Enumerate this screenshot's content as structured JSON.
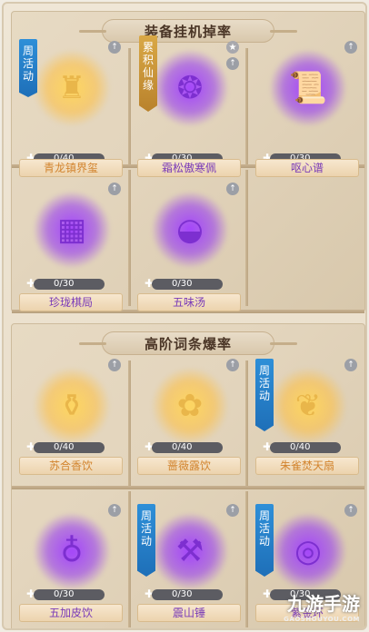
{
  "sections": [
    {
      "title": "装备挂机掉率",
      "items": [
        {
          "name": "青龙镇界玺",
          "progress": "0/40",
          "rarity": "gold",
          "ribbon": "周活动",
          "icon": "seal-icon",
          "glyph": "♜",
          "upgrade": "↑"
        },
        {
          "name": "霜松傲寒佩",
          "progress": "0/30",
          "rarity": "purple",
          "ribbon": "累积仙缘",
          "icon": "pendant-icon",
          "glyph": "❂",
          "upgrade": "★"
        },
        {
          "name": "呕心谱",
          "progress": "0/30",
          "rarity": "purple",
          "ribbon": "",
          "icon": "scroll-icon",
          "glyph": "📜",
          "upgrade": "↑"
        },
        {
          "name": "珍珑棋局",
          "progress": "0/30",
          "rarity": "purple",
          "ribbon": "",
          "icon": "chessboard-icon",
          "glyph": "▦",
          "upgrade": "↑"
        },
        {
          "name": "五味汤",
          "progress": "0/30",
          "rarity": "purple",
          "ribbon": "",
          "icon": "soup-bowl-icon",
          "glyph": "◒",
          "upgrade": "↑"
        }
      ]
    },
    {
      "title": "高阶词条爆率",
      "items": [
        {
          "name": "苏合香饮",
          "progress": "0/40",
          "rarity": "gold",
          "ribbon": "",
          "icon": "wine-bottle-icon",
          "glyph": "⚱",
          "upgrade": "↑"
        },
        {
          "name": "蔷薇露饮",
          "progress": "0/40",
          "rarity": "gold",
          "ribbon": "",
          "icon": "flower-bowl-icon",
          "glyph": "✿",
          "upgrade": "↑"
        },
        {
          "name": "朱雀焚天扇",
          "progress": "0/40",
          "rarity": "gold",
          "ribbon": "周活动",
          "icon": "fan-icon",
          "glyph": "❦",
          "upgrade": "↑"
        },
        {
          "name": "五加皮饮",
          "progress": "0/30",
          "rarity": "purple",
          "ribbon": "",
          "icon": "gourd-icon",
          "glyph": "♁",
          "upgrade": "↑"
        },
        {
          "name": "震山锤",
          "progress": "0/30",
          "rarity": "purple",
          "ribbon": "周活动",
          "icon": "hammer-icon",
          "glyph": "⚒",
          "upgrade": "↑"
        },
        {
          "name": "紫金环",
          "progress": "0/30",
          "rarity": "purple",
          "ribbon": "周活动",
          "icon": "ring-icon",
          "glyph": "◎",
          "upgrade": "↑"
        }
      ]
    }
  ],
  "puzzle_glyph": "✚",
  "watermark": {
    "title": "九游手游",
    "sub": "GAOSHOUYOU.COM"
  },
  "colors": {
    "gold": "#e9b64a",
    "purple": "#7d2fd0",
    "ribbon": "#2e8fd8",
    "namegold": "#d2842e",
    "namepurple": "#7a3bb8"
  }
}
